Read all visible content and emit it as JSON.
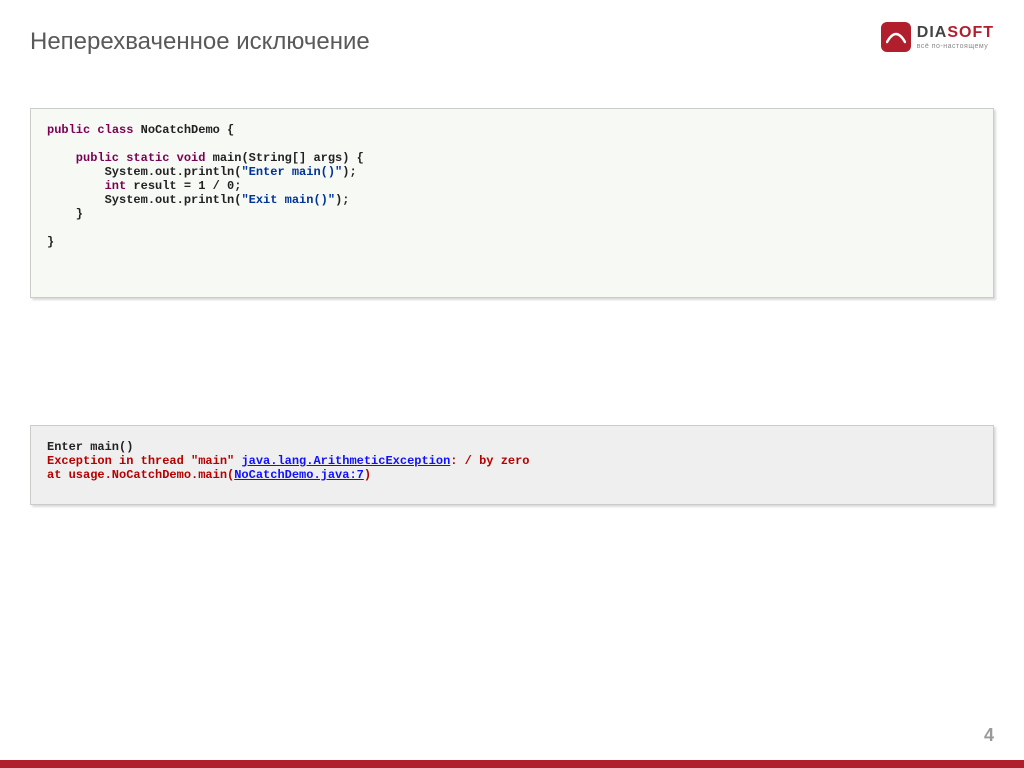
{
  "title": "Неперехваченное исключение",
  "logo": {
    "name_dia": "DIA",
    "name_soft": "SOFT",
    "tagline": "всё по-настоящему"
  },
  "code": {
    "l1_a": "public",
    "l1_b": " class",
    "l1_c": " NoCatchDemo {",
    "l2_a": "    public static void",
    "l2_b": " main(String[] args) {",
    "l3_a": "        System.out.println(",
    "l3_b": "\"Enter main()\"",
    "l3_c": ");",
    "l4_a": "        int",
    "l4_b": " result = ",
    "l4_c": "1",
    "l4_d": " / ",
    "l4_e": "0",
    "l4_f": ";",
    "l5_a": "        System.out.println(",
    "l5_b": "\"Exit main()\"",
    "l5_c": ");",
    "l6": "    }",
    "l7": "}"
  },
  "console": {
    "l1": "Enter main()",
    "l2_a": "Exception in thread \"main\" ",
    "l2_b": "java.lang.ArithmeticException",
    "l2_c": ": / by zero",
    "l3_a": "at usage.NoCatchDemo.main(",
    "l3_b": "NoCatchDemo.java:7",
    "l3_c": ")"
  },
  "page_number": "4"
}
